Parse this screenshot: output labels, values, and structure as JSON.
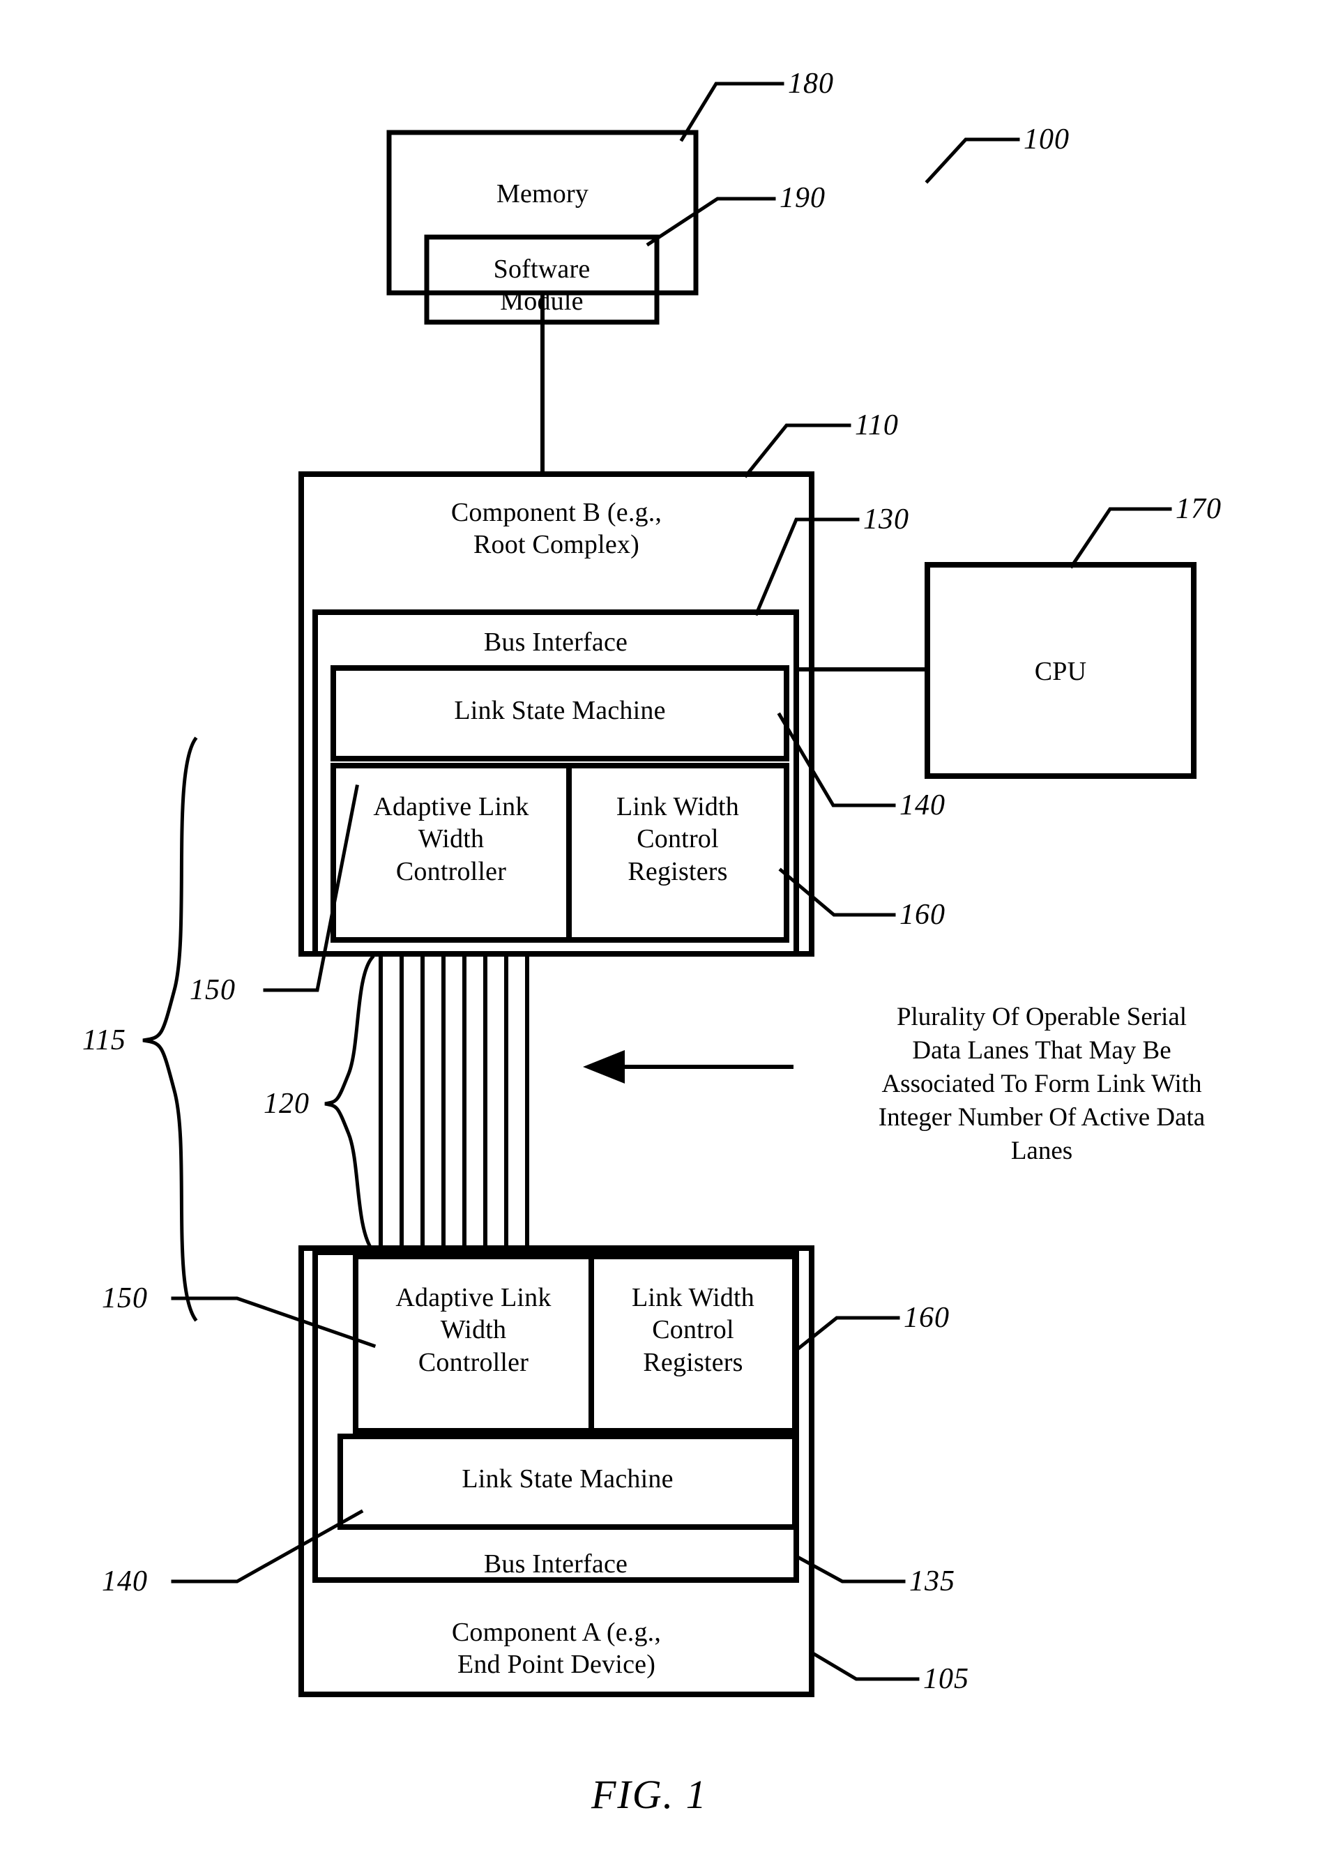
{
  "figure": {
    "caption": "FIG. 1",
    "system_ref": "100"
  },
  "boxes": {
    "memory": {
      "label": "Memory",
      "ref": "180"
    },
    "software_module": {
      "label": "Software\nModule",
      "ref": "190"
    },
    "component_b": {
      "label": "Component B (e.g.,\nRoot Complex)",
      "ref": "110"
    },
    "cpu": {
      "label": "CPU",
      "ref": "170"
    },
    "bus_interface_b": {
      "label": "Bus Interface",
      "ref": "130"
    },
    "link_state_machine_b": {
      "label": "Link State Machine",
      "ref": "140"
    },
    "adaptive_link_width_controller_b": {
      "label": "Adaptive Link\nWidth\nController",
      "ref": "150"
    },
    "link_width_control_registers_b": {
      "label": "Link Width\nControl\nRegisters",
      "ref": "160"
    },
    "adaptive_link_width_controller_a": {
      "label": "Adaptive Link\nWidth\nController",
      "ref": "150"
    },
    "link_width_control_registers_a": {
      "label": "Link Width\nControl\nRegisters",
      "ref": "160"
    },
    "link_state_machine_a": {
      "label": "Link State Machine",
      "ref": "140"
    },
    "bus_interface_a": {
      "label": "Bus Interface",
      "ref": "135"
    },
    "component_a": {
      "label": "Component A (e.g.,\nEnd Point Device)",
      "ref": "105"
    }
  },
  "braces": {
    "link_ref": "115",
    "lanes_ref": "120"
  },
  "annotations": {
    "lanes_note": "Plurality Of Operable Serial\nData Lanes That May Be\nAssociated To Form Link With\nInteger Number Of Active Data\nLanes"
  }
}
